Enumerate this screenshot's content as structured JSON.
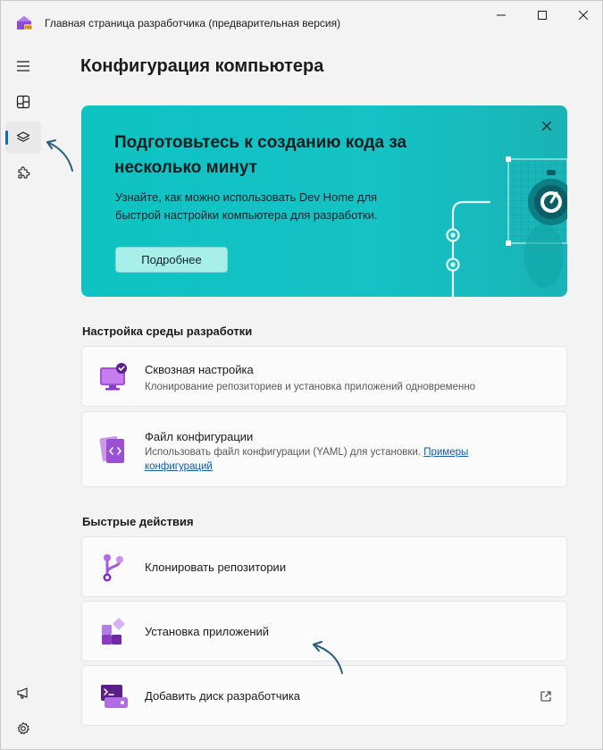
{
  "window": {
    "title": "Главная страница разработчика (предварительная версия)"
  },
  "nav": {
    "items": [
      {
        "icon": "hamburger-menu-icon"
      },
      {
        "icon": "dashboard-icon"
      },
      {
        "icon": "machine-configuration-icon",
        "selected": true
      },
      {
        "icon": "extensions-icon"
      },
      {
        "icon": "feedback-icon"
      },
      {
        "icon": "settings-icon"
      }
    ]
  },
  "page": {
    "title": "Конфигурация компьютера"
  },
  "banner": {
    "title": "Подготовьтесь к созданию кода за несколько минут",
    "text": "Узнайте, как можно использовать Dev Home для быстрой настройки компьютера для разработки.",
    "button_label": "Подробнее"
  },
  "dev_env": {
    "section_title": "Настройка среды разработки",
    "cards": [
      {
        "title": "Сквозная настройка",
        "description": "Клонирование репозиториев и установка приложений одновременно"
      },
      {
        "title": "Файл конфигурации",
        "description": "Использовать файл конфигурации (YAML) для установки.",
        "link": "Примеры конфигураций"
      }
    ]
  },
  "quick_actions": {
    "section_title": "Быстрые действия",
    "cards": [
      {
        "title": "Клонировать репозитории"
      },
      {
        "title": "Установка приложений"
      },
      {
        "title": "Добавить диск разработчика"
      }
    ]
  },
  "colors": {
    "accent": "#0f6cbd",
    "banner": "#12c2c3",
    "annotation_arrow": "#2a5d7c"
  }
}
